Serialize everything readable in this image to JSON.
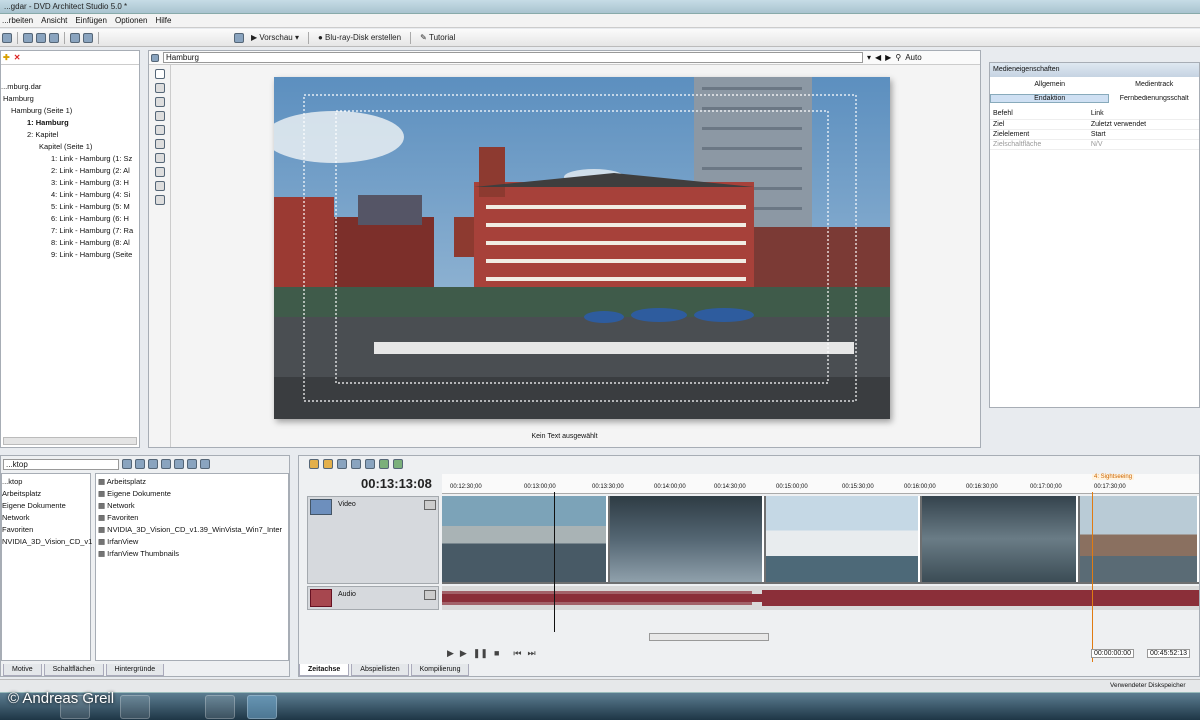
{
  "window": {
    "title": "...gdar - DVD Architect Studio 5.0 *"
  },
  "menu": [
    "...rbeiten",
    "Ansicht",
    "Einfügen",
    "Optionen",
    "Hilfe"
  ],
  "toolbar": {
    "preview": "Vorschau",
    "bluray": "Blu-ray-Disk erstellen",
    "tutorial": "Tutorial"
  },
  "project_tree": {
    "items": [
      "...mburg.dar",
      "Hamburg",
      "Hamburg (Seite 1)",
      "1: Hamburg",
      "2: Kapitel",
      "Kapitel (Seite 1)",
      "1: Link - Hamburg (1: Sz",
      "2: Link - Hamburg (2: Al",
      "3: Link - Hamburg (3: H",
      "4: Link - Hamburg (4: Si",
      "5: Link - Hamburg (5: M",
      "6: Link - Hamburg (6: H",
      "7: Link - Hamburg (7: Ra",
      "8: Link - Hamburg (8: Al",
      "9: Link - Hamburg (Seite"
    ]
  },
  "preview": {
    "title": "Hamburg",
    "zoom": "Auto",
    "status": "Kein Text ausgewählt"
  },
  "properties": {
    "title": "Medieneigenschaften",
    "tabs": [
      "Allgemein",
      "Medientrack",
      "Endaktion",
      "Fernbedienungsschalt"
    ],
    "rows": [
      {
        "label": "Befehl",
        "value": "Link"
      },
      {
        "label": "Ziel",
        "value": "Zuletzt verwendet"
      },
      {
        "label": "Zielelement",
        "value": "Start"
      },
      {
        "label": "Zielschaltfläche",
        "value": "N/V"
      }
    ]
  },
  "explorer": {
    "path": "...ktop",
    "left_items": [
      "...ktop",
      "Arbeitsplatz",
      "Eigene Dokumente",
      "Network",
      "Favoriten",
      "NVIDIA_3D_Vision_CD_v1"
    ],
    "right_items": [
      "Arbeitsplatz",
      "Eigene Dokumente",
      "Network",
      "Favoriten",
      "NVIDIA_3D_Vision_CD_v1.39_WinVista_Win7_Inter",
      "IrfanView",
      "IrfanView Thumbnails"
    ],
    "tabs": [
      "Motive",
      "Schaltflächen",
      "Hintergründe"
    ]
  },
  "timeline": {
    "timecode": "00:13:13:08",
    "ruler": [
      "00:12:30;00",
      "00:13:00;00",
      "00:13:30;00",
      "00:14:00;00",
      "00:14:30;00",
      "00:15:00;00",
      "00:15:30;00",
      "00:16:00;00",
      "00:16:30;00",
      "00:17:00;00",
      "00:17:30;00"
    ],
    "marker": "4: Sightseeing",
    "video_track": "Video",
    "audio_track": "Audio",
    "start_time": "00:00:00:00",
    "end_time": "00:45:52:13",
    "tabs": [
      "Zeitachse",
      "Abspiellisten",
      "Kompilierung"
    ]
  },
  "statusbar": {
    "text": "Verwendeter Diskspeicher"
  },
  "watermark": "© Andreas Greil"
}
